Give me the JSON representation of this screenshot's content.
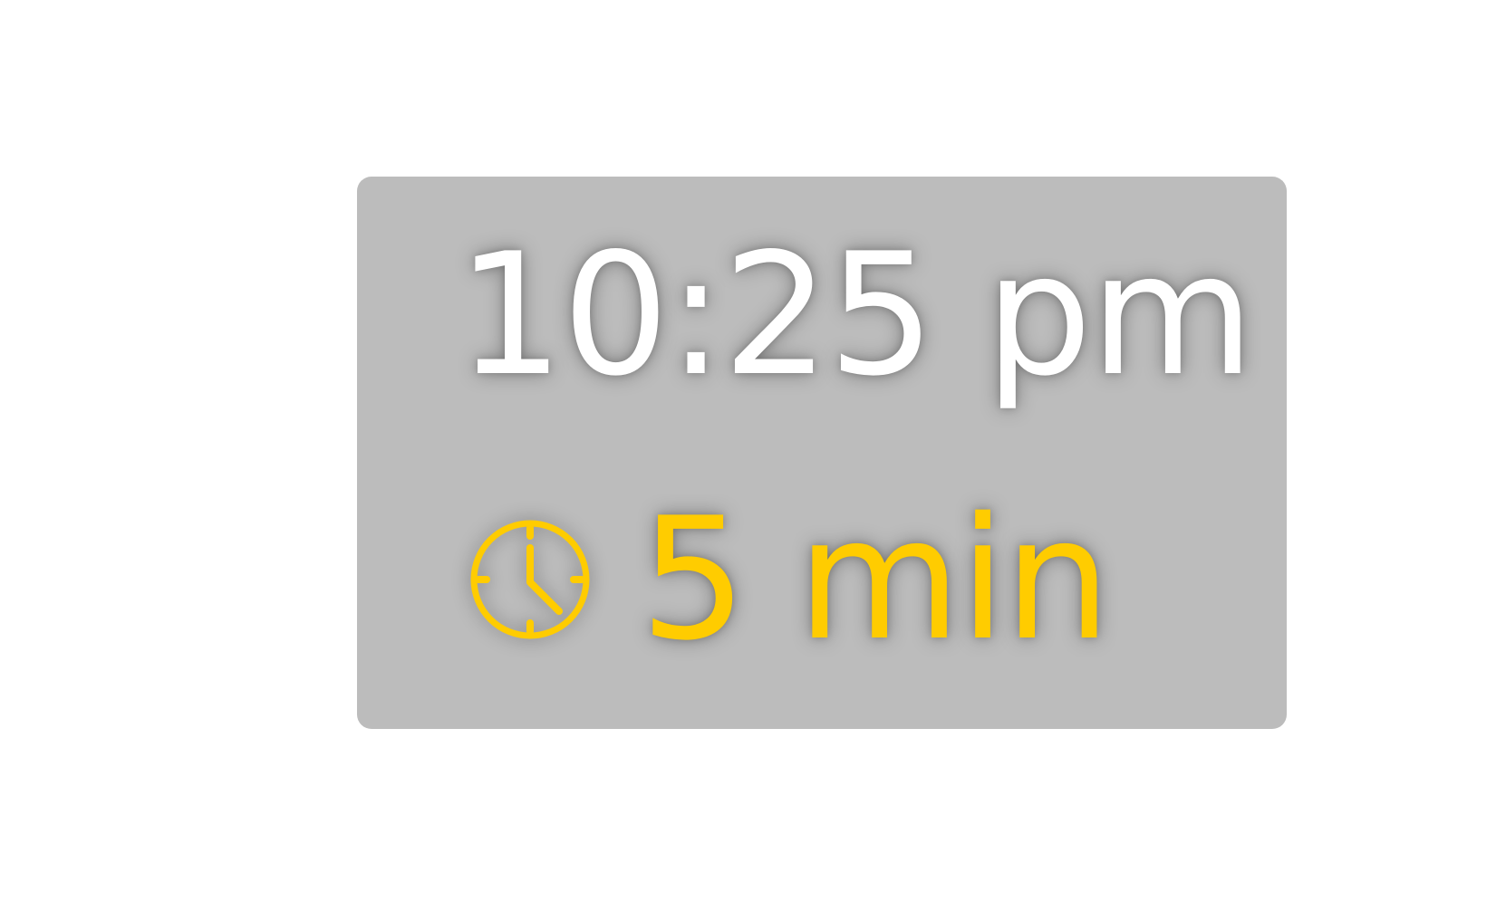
{
  "clock": {
    "time": "10:25 pm"
  },
  "eta": {
    "icon": "clock-icon",
    "value": "5",
    "unit": "min",
    "color": "#ffcc00"
  },
  "card": {
    "background": "#bcbcbc",
    "text_color": "#ffffff"
  }
}
